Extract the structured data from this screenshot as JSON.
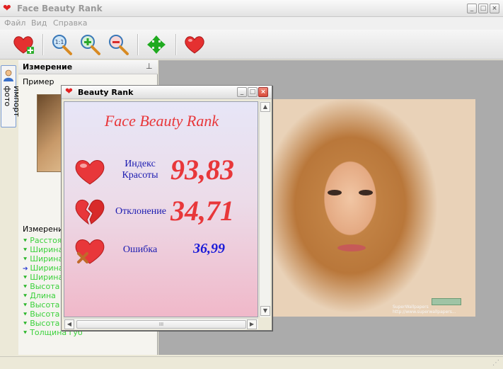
{
  "app": {
    "title": "Face Beauty Rank",
    "window_buttons": {
      "minimize": "_",
      "maximize": "□",
      "close": "×"
    }
  },
  "menu": [
    "Файл",
    "Вид",
    "Справка"
  ],
  "toolbar": {
    "buttons": [
      "add-heart",
      "zoom-1-1",
      "zoom-in",
      "zoom-out",
      "move",
      "heart"
    ]
  },
  "side_tab": {
    "label": "Импорт фото"
  },
  "panel": {
    "title": "Измерение",
    "example_label": "Пример",
    "measure_label": "Измерени",
    "items": [
      "Расстоя",
      "Ширина",
      "Ширина",
      "Ширина",
      "Ширина",
      "Высота",
      "Длина",
      "Высота",
      "Высота",
      "Высота",
      "Толщина губ"
    ],
    "active_index": 3
  },
  "beauty_window": {
    "title": "Beauty Rank",
    "heading": "Face Beauty Rank",
    "metrics": {
      "index_label": "Индекс Красоты",
      "index_value": "93,83",
      "deviation_label": "Отклонение",
      "deviation_value": "34,71",
      "error_label": "Ошибка",
      "error_value": "36,99"
    },
    "scroll_grip": "III"
  },
  "photo": {
    "watermark": "SuperWallpapers http://www.superwallpapers..."
  },
  "colors": {
    "accent_red": "#e8373a",
    "label_blue": "#1a1ab0",
    "value_blue": "#1a1ad8",
    "measure_green": "#3bd13b"
  }
}
